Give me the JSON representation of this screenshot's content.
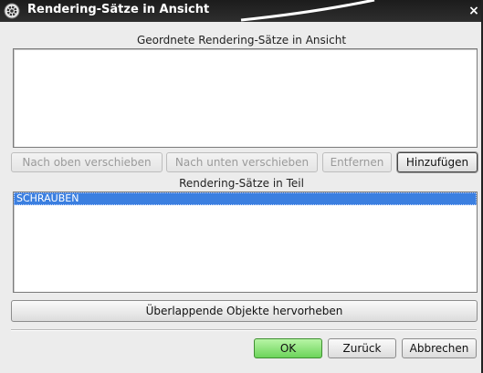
{
  "window": {
    "title": "Rendering-Sätze in Ansicht",
    "close_label": "×",
    "title_icon": "gear-icon"
  },
  "ordered_section": {
    "label": "Geordnete Rendering-Sätze in Ansicht",
    "items": []
  },
  "order_buttons": {
    "move_up": "Nach oben verschieben",
    "move_down": "Nach unten verschieben",
    "remove": "Entfernen",
    "add": "Hinzufügen"
  },
  "part_section": {
    "label": "Rendering-Sätze in Teil",
    "items": [
      "SCHRAUBEN"
    ],
    "selected_index": 0
  },
  "highlight_button": "Überlappende Objekte hervorheben",
  "footer": {
    "ok": "OK",
    "back": "Zurück",
    "cancel": "Abbrechen"
  },
  "colors": {
    "selection": "#3b7fe0",
    "ok_button": "#6cd45a",
    "titlebar": "#1c1c1c"
  }
}
